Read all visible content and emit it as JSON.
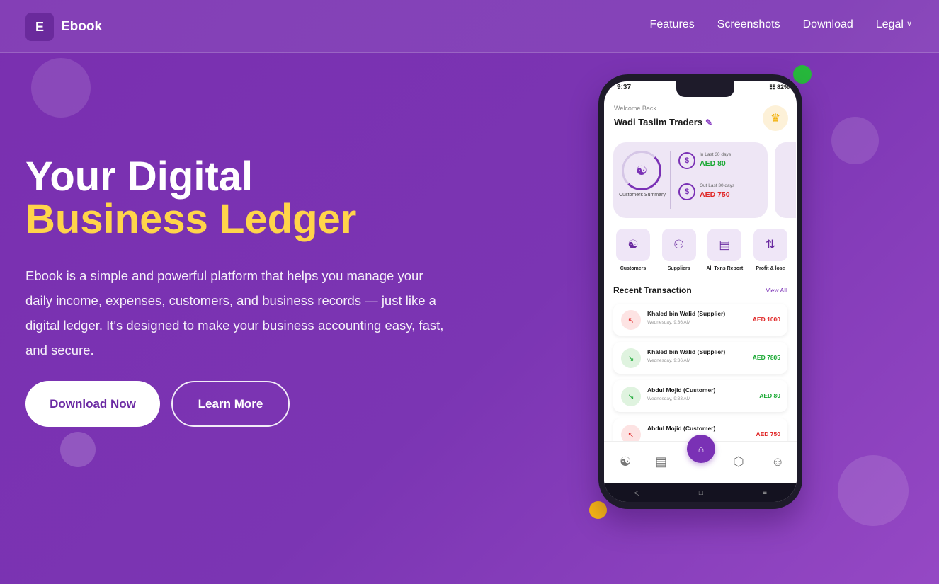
{
  "nav": {
    "logo_letter": "E",
    "brand": "Ebook",
    "links": [
      "Features",
      "Screenshots",
      "Download",
      "Legal"
    ],
    "dropdown_icon": "chevron-down-icon"
  },
  "hero": {
    "title_line1": "Your Digital",
    "title_line2": "Business Ledger",
    "description": "Ebook is a simple and powerful platform that helps you manage your daily income, expenses, customers, and business records — just like a digital ledger. It's designed to make your business accounting easy, fast, and secure.",
    "primary_button": "Download Now",
    "secondary_button": "Learn More"
  },
  "colors": {
    "accent": "#7a31b5",
    "highlight": "#ffd44a",
    "income": "#18a832",
    "expense": "#e02828"
  },
  "phone": {
    "status_time": "9:37",
    "status_right": "82%",
    "welcome": "Welcome Back",
    "business_name": "Wadi Taslim Traders",
    "summary": {
      "label": "Customers Summary",
      "in_caption": "In Last 30 days",
      "in_amount": "AED 80",
      "out_caption": "Out Last 30 days",
      "out_amount": "AED 750"
    },
    "quick_actions": [
      "Customers",
      "Suppliers",
      "All Txns Report",
      "Profit & lose"
    ],
    "recent_title": "Recent Transaction",
    "view_all": "View All",
    "transactions": [
      {
        "name": "Khaled bin Walid (Supplier)",
        "time": "Wednesday, 9:36 AM",
        "amount": "AED 1000",
        "direction": "out"
      },
      {
        "name": "Khaled bin Walid (Supplier)",
        "time": "Wednesday, 9:36 AM",
        "amount": "AED 7805",
        "direction": "in"
      },
      {
        "name": "Abdul Mojid (Customer)",
        "time": "Wednesday, 9:33 AM",
        "amount": "AED 80",
        "direction": "in"
      },
      {
        "name": "Abdul Mojid (Customer)",
        "time": "",
        "amount": "AED 750",
        "direction": "out"
      }
    ]
  }
}
